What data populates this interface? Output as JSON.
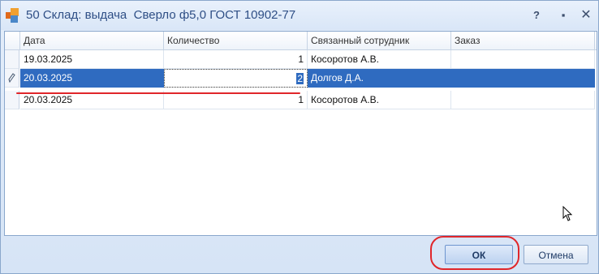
{
  "window": {
    "title": "50 Склад: выдача  Сверло ф5,0 ГОСТ 10902-77",
    "help_glyph": "?",
    "minimize_glyph": "▪",
    "close_glyph": "✕"
  },
  "table": {
    "columns": [
      "Дата",
      "Количество",
      "Связанный сотрудник",
      "Заказ"
    ],
    "rows": [
      {
        "date": "19.03.2025",
        "qty": "1",
        "employee": "Косоротов А.В.",
        "order": ""
      },
      {
        "date": "20.03.2025",
        "qty": "2",
        "employee": "Долгов Д.А.",
        "order": ""
      },
      {
        "date": "20.03.2025",
        "qty": "1",
        "employee": "Косоротов А.В.",
        "order": ""
      }
    ],
    "selected_row": 1
  },
  "buttons": {
    "ok": "ОК",
    "cancel": "Отмена"
  },
  "colors": {
    "selection": "#2f6bc0",
    "highlight_annotation": "#e0262a"
  },
  "icons": {
    "app": "app-icon",
    "edit_row": "pencil-icon",
    "mouse": "cursor-icon"
  }
}
